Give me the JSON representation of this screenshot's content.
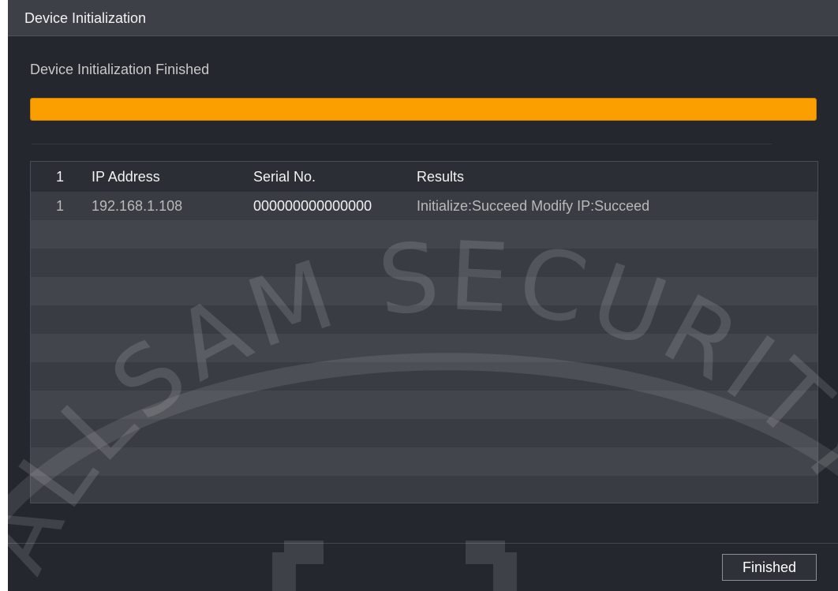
{
  "dialog": {
    "title": "Device Initialization",
    "status": "Device Initialization Finished",
    "progress": 1.0,
    "accent_color": "#fb9f00"
  },
  "table": {
    "headers": {
      "num": "1",
      "ip": "IP Address",
      "serial": "Serial No.",
      "results": "Results"
    },
    "rows": [
      {
        "num": "1",
        "ip": "192.168.1.108",
        "serial": "000000000000000",
        "results": "Initialize:Succeed Modify IP:Succeed"
      }
    ],
    "empty_rows": 10
  },
  "footer": {
    "finished_label": "Finished"
  },
  "watermark": {
    "text": "ALLSAM SECURITY"
  }
}
